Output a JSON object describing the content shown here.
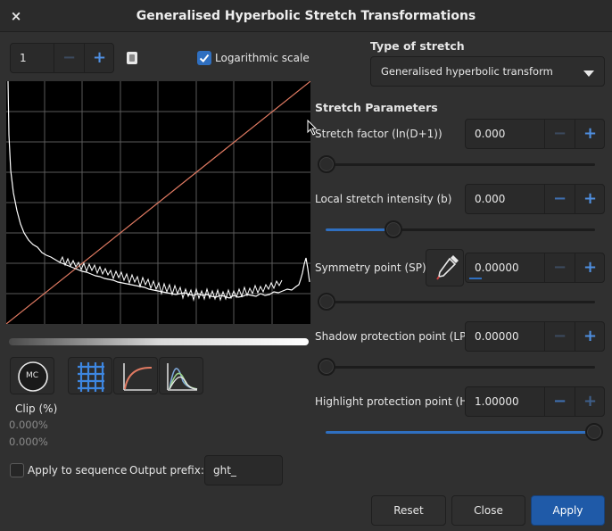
{
  "window": {
    "title": "Generalised Hyperbolic Stretch Transformations"
  },
  "left": {
    "channel_value": "1",
    "log_scale_label": "Logarithmic scale",
    "mc_label": "MC",
    "clip_label": "Clip (%)",
    "clip_low": "0.000%",
    "clip_high": "0.000%",
    "apply_sequence_label": "Apply to sequence",
    "output_prefix_label": "Output prefix:",
    "output_prefix_value": "ght_"
  },
  "right": {
    "type_label": "Type of stretch",
    "type_value": "Generalised hyperbolic transform",
    "params_label": "Stretch Parameters",
    "params": [
      {
        "label": "Stretch factor (ln(D+1))",
        "value": "0.000",
        "slider": 0.0
      },
      {
        "label": "Local stretch intensity (b)",
        "value": "0.000",
        "slider": 0.25
      },
      {
        "label": "Symmetry point (SP)",
        "value": "0.00000",
        "slider": 0.0
      },
      {
        "label": "Shadow protection point (LP)",
        "value": "0.00000",
        "slider": 0.0
      },
      {
        "label": "Highlight protection point (HP)",
        "value": "1.00000",
        "slider": 1.0
      }
    ]
  },
  "buttons": {
    "reset": "Reset",
    "close": "Close",
    "apply": "Apply"
  },
  "colors": {
    "accent": "#2f6fc0",
    "curve": "#e07a62",
    "histogram": "#ffffff"
  },
  "icons": {
    "close": "×",
    "minus": "−",
    "plus": "+"
  }
}
